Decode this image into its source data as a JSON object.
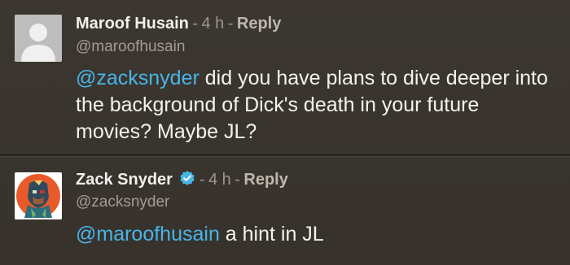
{
  "comments": [
    {
      "author": "Maroof Husain",
      "time": "4 h",
      "reply_label": "Reply",
      "separator": "-",
      "handle": "@maroofhusain",
      "verified": false,
      "avatar": "default-avatar-icon",
      "body_mention": "@zacksnyder",
      "body_text": " did you have plans to dive deeper into the background of Dick's death in your future movies? Maybe JL?"
    },
    {
      "author": "Zack Snyder",
      "time": "4 h",
      "reply_label": "Reply",
      "separator": "-",
      "handle": "@zacksnyder",
      "verified": true,
      "avatar": "profile-illustration-avatar",
      "body_mention": "@maroofhusain",
      "body_text": " a hint in JL"
    }
  ],
  "colors": {
    "background": "#3a352f",
    "mention": "#48b5e8",
    "verified_badge": "#48b5e8",
    "avatar_bg_orange": "#e85a2a"
  }
}
